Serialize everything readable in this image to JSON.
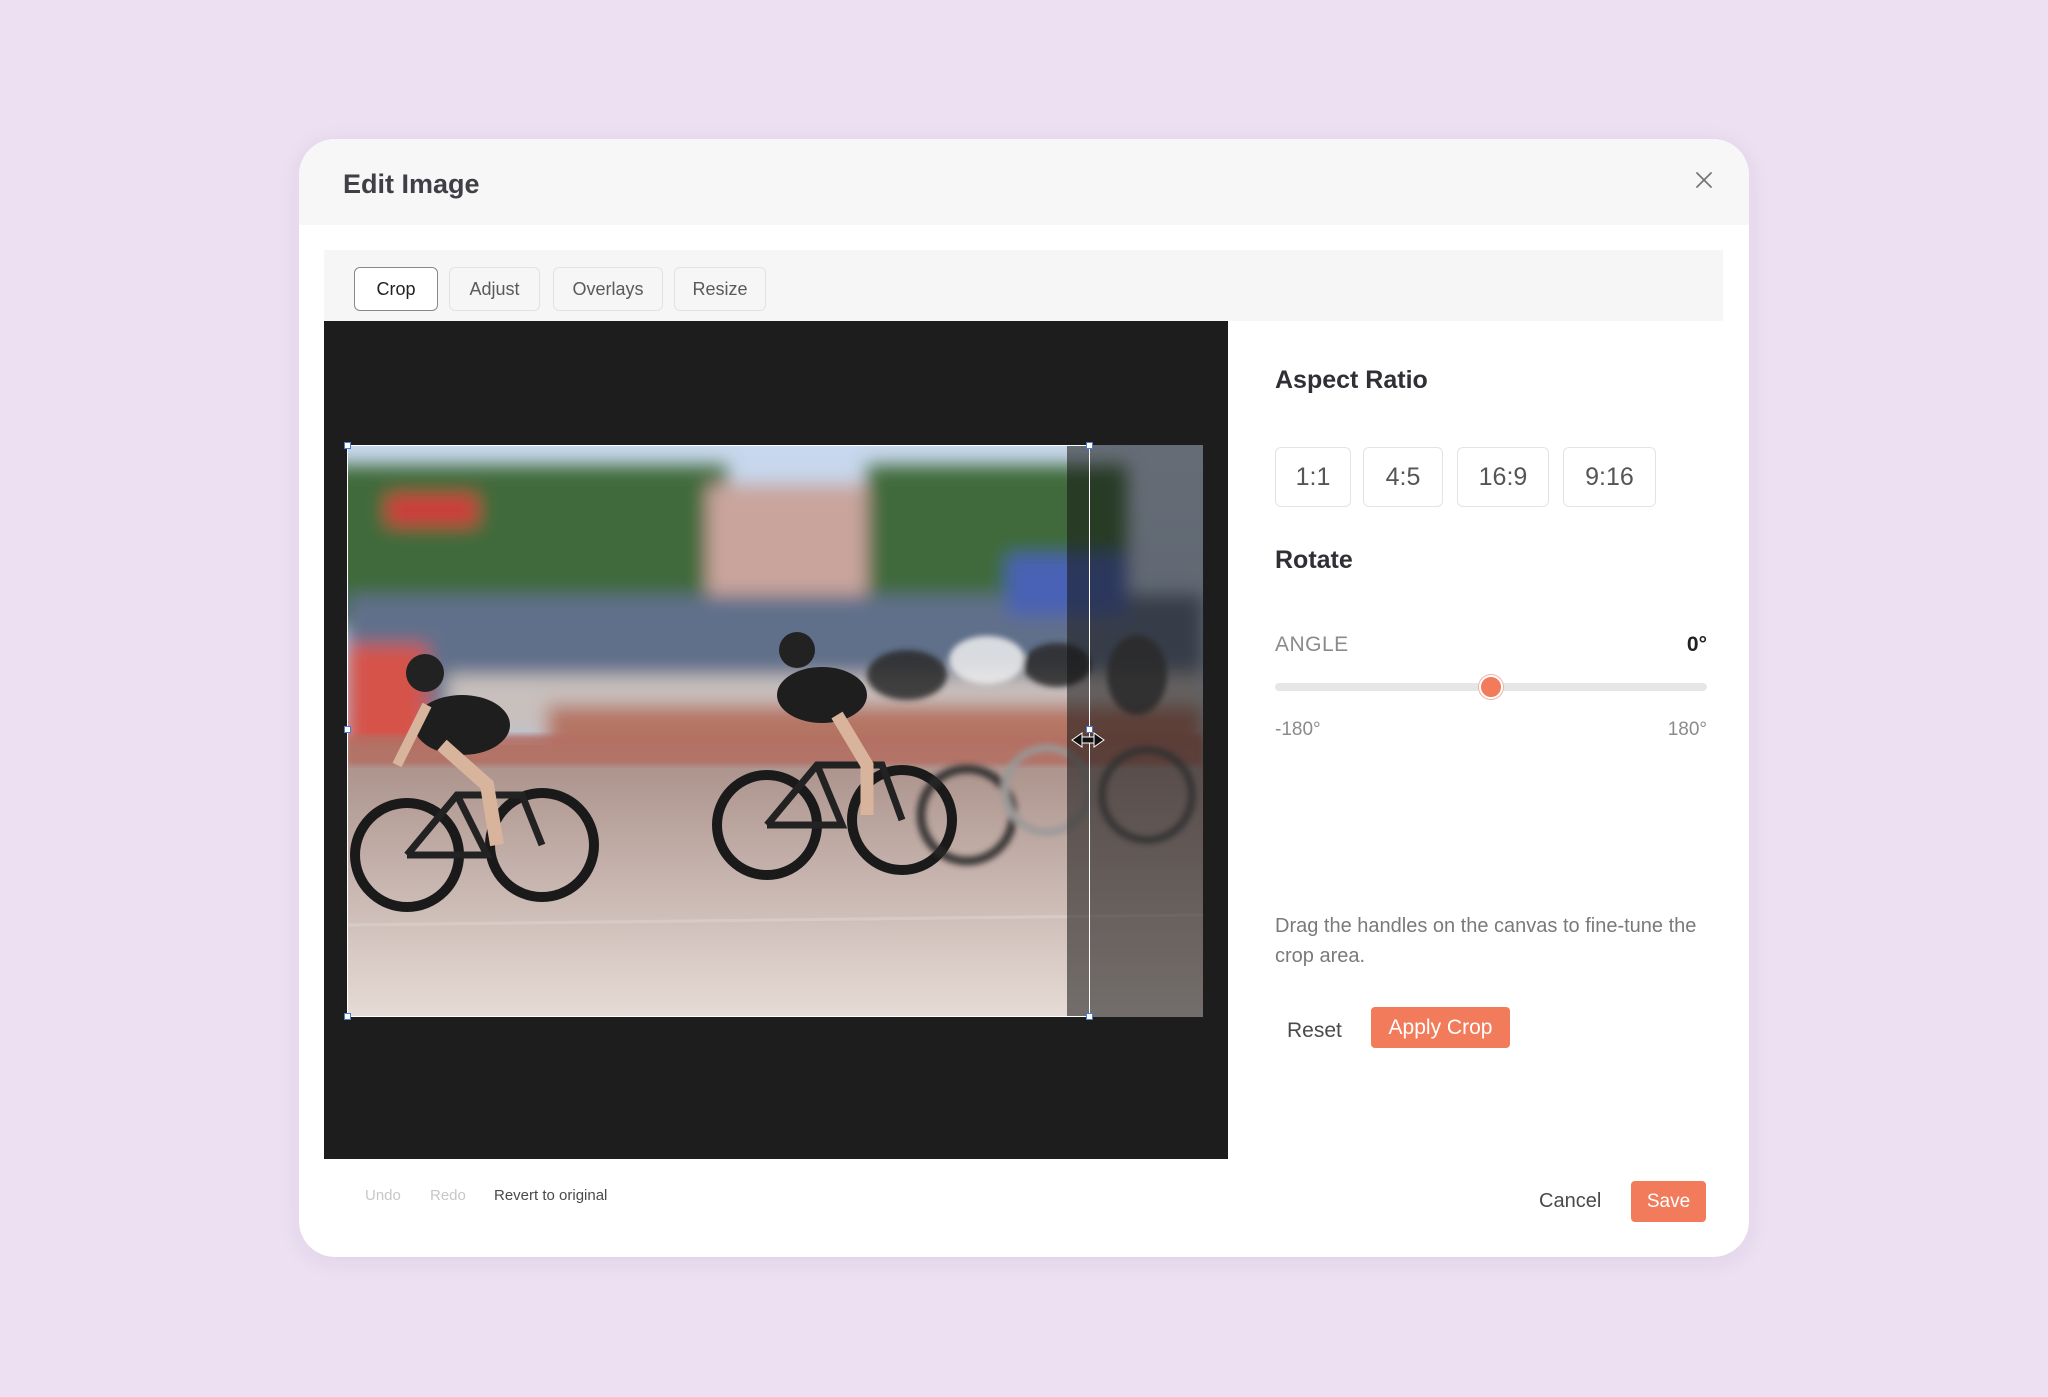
{
  "dialog": {
    "title": "Edit Image"
  },
  "tabs": [
    {
      "label": "Crop",
      "active": true
    },
    {
      "label": "Adjust",
      "active": false
    },
    {
      "label": "Overlays",
      "active": false
    },
    {
      "label": "Resize",
      "active": false
    }
  ],
  "side_panel": {
    "aspect_ratio_title": "Aspect Ratio",
    "ratios": [
      "1:1",
      "4:5",
      "16:9",
      "9:16"
    ],
    "rotate_title": "Rotate",
    "angle_label": "ANGLE",
    "angle_value": "0°",
    "angle_min": "-180°",
    "angle_max": "180°",
    "angle_fraction": 0.5,
    "hint": "Drag the handles on the canvas to fine-tune the crop area.",
    "reset_label": "Reset",
    "apply_label": "Apply Crop"
  },
  "footer": {
    "undo_label": "Undo",
    "redo_label": "Redo",
    "revert_label": "Revert to original",
    "cancel_label": "Cancel",
    "save_label": "Save"
  },
  "colors": {
    "accent": "#f27b5b",
    "background": "#ede0f2",
    "canvas": "#1d1d1d"
  },
  "icons": {
    "close": "close-icon",
    "resize_cursor": "horizontal-resize-cursor-icon"
  }
}
